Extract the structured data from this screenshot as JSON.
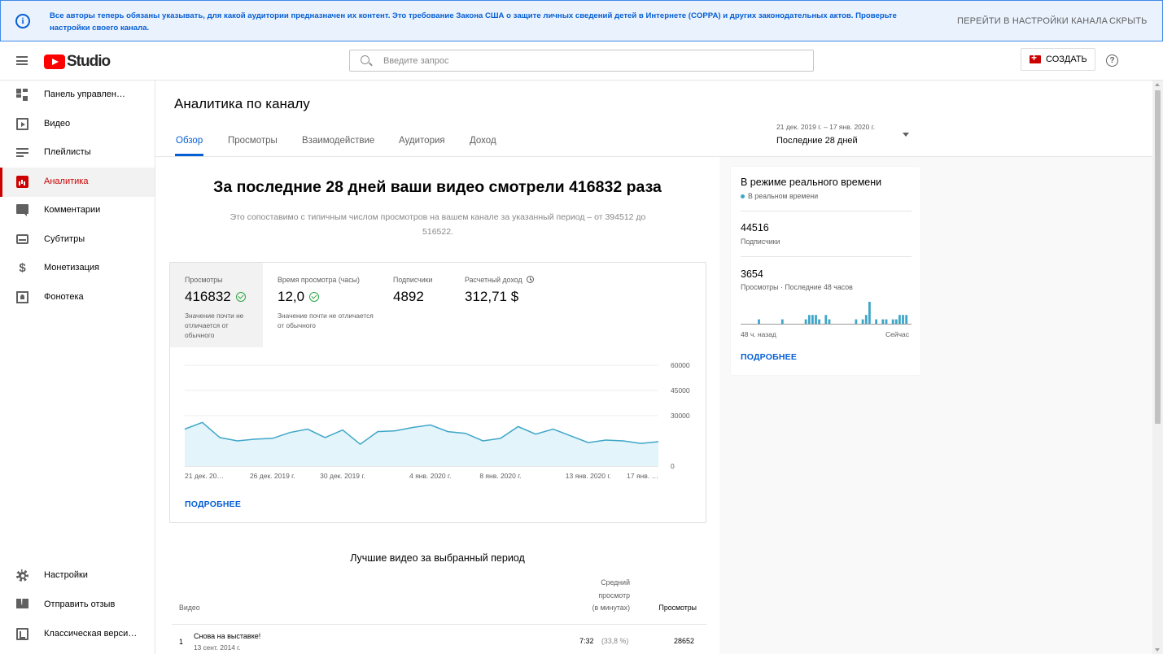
{
  "banner": {
    "message": "Все авторы теперь обязаны указывать, для какой аудитории предназначен их контент. Это требование Закона США о защите личных сведений детей в Интернете (COPPA) и других законодательных актов. Проверьте настройки своего канала.",
    "settings_link": "ПЕРЕЙТИ В НАСТРОЙКИ КАНАЛА",
    "hide_link": "СКРЫТЬ",
    "icon": "info-icon"
  },
  "header": {
    "logo_text": "Studio",
    "search_placeholder": "Введите запрос",
    "create_label": "СОЗДАТЬ",
    "help_icon": "help-icon",
    "help_glyph": "?"
  },
  "sidebar": {
    "items": [
      {
        "label": "Панель управлен…",
        "icon": "dashboard-icon"
      },
      {
        "label": "Видео",
        "icon": "video-icon"
      },
      {
        "label": "Плейлисты",
        "icon": "playlist-icon"
      },
      {
        "label": "Аналитика",
        "icon": "analytics-icon",
        "active": true
      },
      {
        "label": "Комментарии",
        "icon": "comments-icon"
      },
      {
        "label": "Субтитры",
        "icon": "subtitles-icon"
      },
      {
        "label": "Монетизация",
        "icon": "dollar-icon"
      },
      {
        "label": "Фонотека",
        "icon": "audio-library-icon"
      }
    ],
    "bottom_items": [
      {
        "label": "Настройки",
        "icon": "gear-icon"
      },
      {
        "label": "Отправить отзыв",
        "icon": "feedback-icon"
      },
      {
        "label": "Классическая верси…",
        "icon": "classic-icon"
      }
    ]
  },
  "page": {
    "title": "Аналитика по каналу",
    "tabs": [
      {
        "label": "Обзор",
        "active": true
      },
      {
        "label": "Просмотры"
      },
      {
        "label": "Взаимодействие"
      },
      {
        "label": "Аудитория"
      },
      {
        "label": "Доход"
      }
    ],
    "date_range": "21 дек. 2019 г. – 17 янв. 2020 г.",
    "date_label": "Последние 28 дней"
  },
  "overview": {
    "headline": "За последние 28 дней ваши видео смотрели 416832 раза",
    "subline": "Это сопоставимо с типичным числом просмотров на вашем канале за указанный период – от 394512 до 516522.",
    "metrics": [
      {
        "label": "Просмотры",
        "value": "416832",
        "note": "Значение почти не отличается от обычного",
        "check": true,
        "selected": true
      },
      {
        "label": "Время просмотра (часы)",
        "value": "12,0",
        "note": "Значение почти не отличается от обычного",
        "check": true
      },
      {
        "label": "Подписчики",
        "value": "4892"
      },
      {
        "label": "Расчетный доход",
        "value": "312,71 $",
        "clock": true
      }
    ],
    "more_label": "ПОДРОБНЕЕ"
  },
  "chart_data": [
    {
      "type": "area",
      "ylabel": "",
      "xlabel": "",
      "ylim": [
        0,
        60000
      ],
      "y_ticks": [
        "60000",
        "45000",
        "30000",
        "0"
      ],
      "x_ticks": [
        "21 дек. 20…",
        "26 дек. 2019 г.",
        "30 дек. 2019 г.",
        "4 янв. 2020 г.",
        "8 янв. 2020 г.",
        "13 янв. 2020 г.",
        "17 янв. …"
      ],
      "grid": true,
      "color": "#3ea6c8",
      "series": [
        {
          "values": [
            22000,
            26000,
            17000,
            15000,
            16000,
            16500,
            20000,
            22000,
            17000,
            21500,
            13000,
            20500,
            21000,
            23000,
            24500,
            20500,
            19500,
            15000,
            16500,
            23500,
            19000,
            22000,
            18000,
            14000,
            15500,
            15000,
            13500,
            14500
          ]
        }
      ]
    },
    {
      "type": "bar",
      "title": "В режиме реального времени",
      "x_start": "48 ч. назад",
      "x_end": "Сейчас",
      "color": "#3ea6c8",
      "values": [
        0,
        0,
        0,
        0,
        0,
        1,
        0,
        0,
        0,
        0,
        0,
        0,
        1,
        0,
        0,
        0,
        0,
        0,
        0,
        1,
        2,
        2,
        2,
        1,
        0,
        2,
        1,
        0,
        0,
        0,
        0,
        0,
        0,
        0,
        1,
        0,
        1,
        2,
        5,
        0,
        1,
        0,
        1,
        1,
        0,
        1,
        1,
        2,
        2,
        2,
        0
      ]
    }
  ],
  "realtime": {
    "title": "В режиме реального времени",
    "live_label": "В реальном времени",
    "subscribers_value": "44516",
    "subscribers_label": "Подписчики",
    "views_value": "3654",
    "views_label": "Просмотры · Последние 48 часов",
    "x_start": "48 ч. назад",
    "x_end": "Сейчас",
    "more_label": "ПОДРОБНЕЕ"
  },
  "top_videos": {
    "title": "Лучшие видео за выбранный период",
    "col_video": "Видео",
    "col_avg_1": "Средний",
    "col_avg_2": "просмотр",
    "col_avg_3": "(в минутах)",
    "col_views": "Просмотры",
    "rows": [
      {
        "rank": "1",
        "title": "Снова на выставке!",
        "date": "13 сент. 2014 г.",
        "avg": "7:32",
        "avg_pct": "(33,8 %)",
        "views": "28652"
      }
    ]
  }
}
